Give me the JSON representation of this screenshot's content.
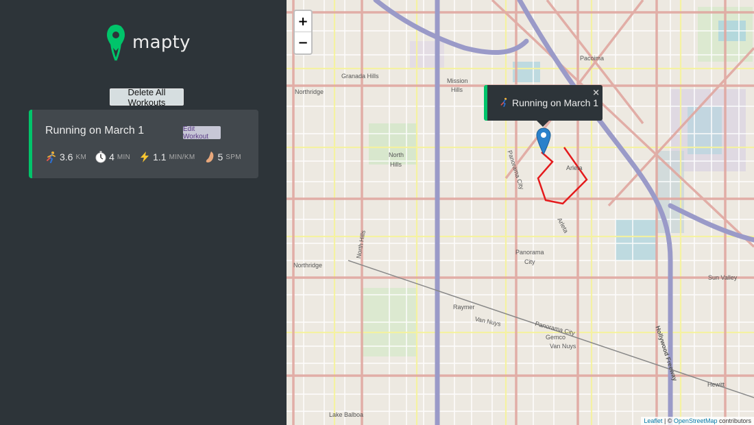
{
  "sidebar": {
    "logo_text": "mapty",
    "delete_all_label": "Delete All Workouts"
  },
  "workouts": [
    {
      "title": "Running on March 1",
      "edit_label": "Edit Workout",
      "distance": "3.6",
      "distance_unit": "KM",
      "duration": "4",
      "duration_unit": "MIN",
      "pace": "1.1",
      "pace_unit": "MIN/KM",
      "cadence": "5",
      "cadence_unit": "SPM",
      "icons": [
        "running-icon",
        "stopwatch-icon",
        "lightning-icon",
        "foot-icon"
      ]
    }
  ],
  "map": {
    "zoom_in": "+",
    "zoom_out": "−",
    "popup_text": "Running on March 1",
    "popup_close": "×",
    "attribution_leaflet": "Leaflet",
    "attribution_sep": " | © ",
    "attribution_osm": "OpenStreetMap",
    "attribution_tail": " contributors",
    "labels": {
      "pacoima": "Pacoima",
      "granada_hills": "Granada Hills",
      "mission": "Mission",
      "hills": "Hills",
      "northridge1": "Northridge",
      "north": "North",
      "north_hills_hills": "Hills",
      "panorama_city_road": "Panorama City",
      "arleta": "Arleta",
      "arleta_road": "Arleta",
      "north_hills_road": "North Hills",
      "northridge2": "Northridge",
      "panorama": "Panorama",
      "city": "City",
      "raymer": "Raymer",
      "van_nuys1": "Van Nuys",
      "panorama_city2": "Panorama City",
      "gemco": "Gemco",
      "van_nuys2": "Van Nuys",
      "sun_valley": "Sun Valley",
      "hollywood_freeway": "Hollywood Freeway",
      "hewitt": "Hewitt",
      "lake_balboa": "Lake Balboa"
    }
  },
  "colors": {
    "sidebar_bg": "#2d3439",
    "card_bg": "#42484d",
    "accent_running": "#00c46a",
    "route": "#e41a1c",
    "marker": "#2a81cb"
  }
}
